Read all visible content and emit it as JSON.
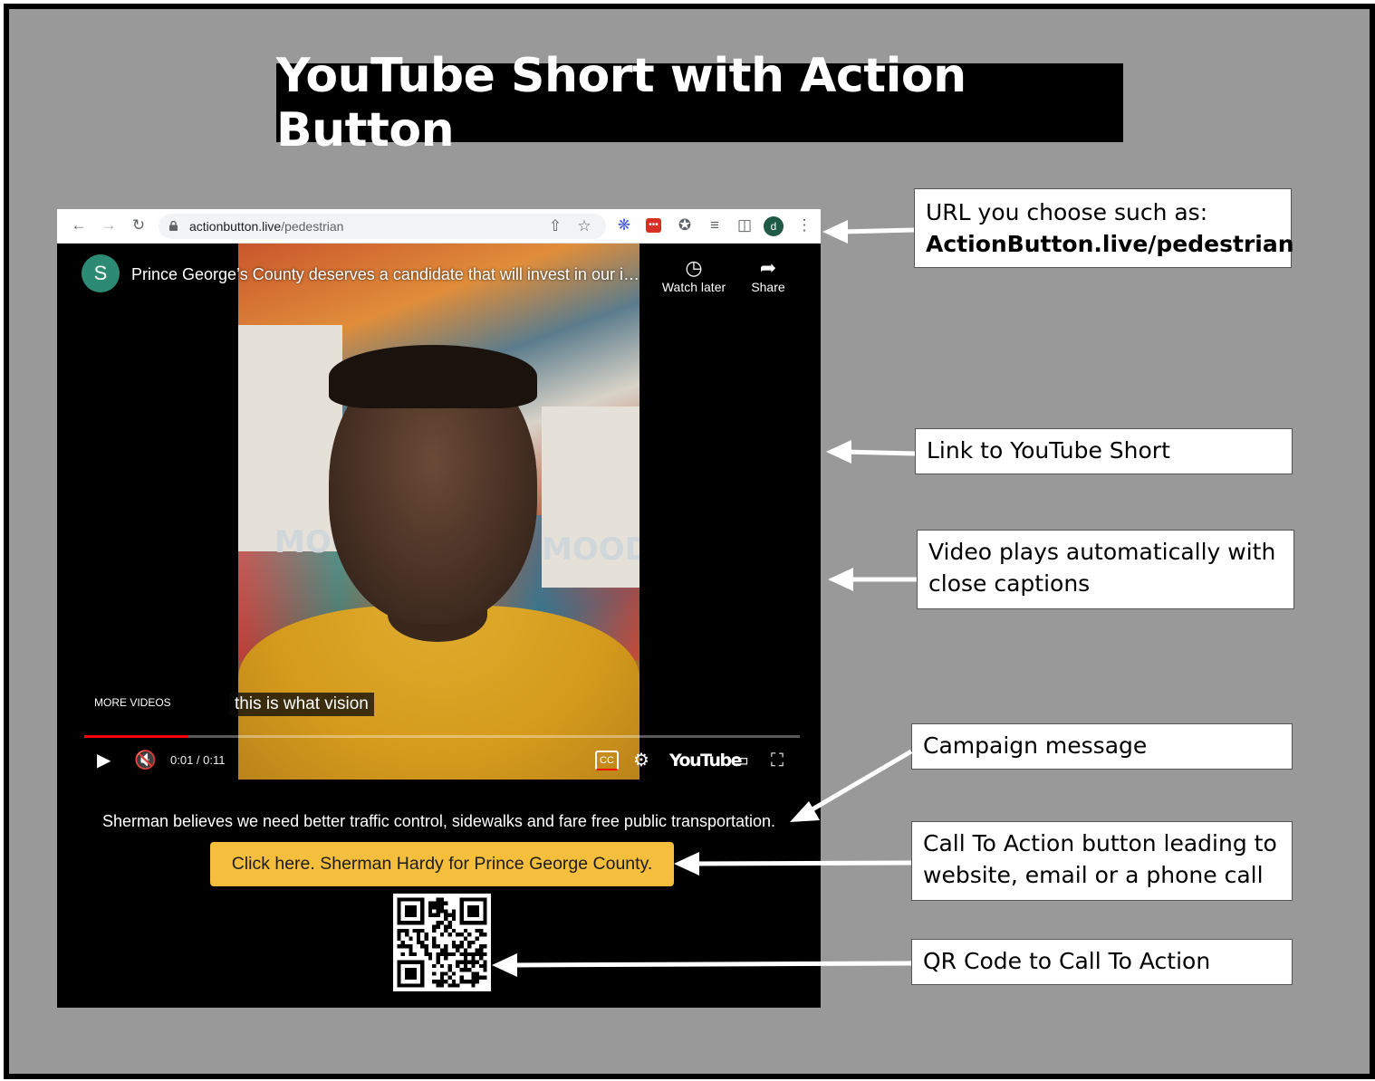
{
  "slide_title": "YouTube Short with Action Button",
  "browser": {
    "url_domain": "actionbutton.live",
    "url_path": "/pedestrian",
    "profile_initial": "d",
    "back_icon": "arrow-left-icon",
    "forward_icon": "arrow-right-icon",
    "reload_icon": "reload-icon",
    "share_icon": "share-icon",
    "bookmark_icon": "star-icon",
    "extensions_icon": "puzzle-icon",
    "menu_icon": "kebab-menu-icon"
  },
  "video": {
    "channel_initial": "S",
    "title": "Prince George’s County deserves a candidate that will invest in our infrastructure",
    "watch_later_label": "Watch later",
    "share_label": "Share",
    "more_videos_label": "MORE VIDEOS",
    "caption_text": "this is what vision",
    "time_current": "0:01",
    "time_total": "0:11",
    "time_display": "0:01 / 0:11",
    "progress_fraction": 0.145,
    "mural_word": "MOOD.",
    "youtube_logo_text": "YouTube"
  },
  "page": {
    "campaign_message": "Sherman believes we need better traffic control, sidewalks and fare free public transportation.",
    "cta_label": "Click here. Sherman Hardy for Prince George County.",
    "cta_color": "#f6be3d"
  },
  "callouts": {
    "url": {
      "line1": "URL you choose such as:",
      "line2": "ActionButton.live/pedestrian"
    },
    "link": "Link to YouTube Short",
    "video": {
      "line1": "Video plays automatically with",
      "line2": "close captions"
    },
    "campaign": "Campaign message",
    "cta": {
      "line1": "Call To Action button leading to",
      "line2": "website, email or a phone call"
    },
    "qr": "QR Code to Call To Action"
  }
}
